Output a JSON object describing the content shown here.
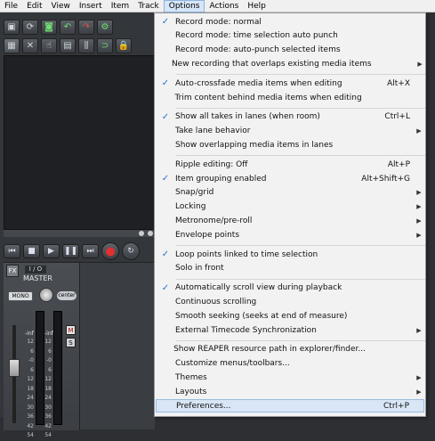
{
  "menubar": {
    "items": [
      "File",
      "Edit",
      "View",
      "Insert",
      "Item",
      "Track",
      "Options",
      "Actions",
      "Help"
    ],
    "active_index": 6
  },
  "toolbar": {
    "row1_icons": [
      "new-project-icon",
      "open-project-icon",
      "save-project-icon",
      "undo-icon",
      "redo-icon",
      "settings-icon"
    ],
    "row2_icons": [
      "grid-icon",
      "snap-icon",
      "ripple-icon",
      "envelope-icon",
      "lock-icon",
      "lock-icon"
    ]
  },
  "transport": {
    "buttons": [
      "go-to-start",
      "stop",
      "play",
      "pause",
      "go-to-end",
      "record",
      "loop"
    ]
  },
  "mixer": {
    "io_label": "I / O",
    "track_name": "MASTER",
    "mono_label": "MONO",
    "pan_label": "center",
    "fx_label": "FX",
    "mute": "M",
    "solo": "S",
    "inf_left": "-inf",
    "inf_right": "-inf",
    "ticks": [
      "12",
      "6",
      "-0",
      "6",
      "12",
      "18",
      "24",
      "30",
      "36",
      "42",
      "54"
    ]
  },
  "options_menu": {
    "sections": [
      [
        {
          "label": "Record mode: normal",
          "checked": true,
          "shortcut": "",
          "submenu": false
        },
        {
          "label": "Record mode: time selection auto punch",
          "checked": false,
          "shortcut": "",
          "submenu": false
        },
        {
          "label": "Record mode: auto-punch selected items",
          "checked": false,
          "shortcut": "",
          "submenu": false
        },
        {
          "label": "New recording that overlaps existing media items",
          "checked": false,
          "shortcut": "",
          "submenu": true
        }
      ],
      [
        {
          "label": "Auto-crossfade media items when editing",
          "checked": true,
          "shortcut": "Alt+X",
          "submenu": false
        },
        {
          "label": "Trim content behind media items when editing",
          "checked": false,
          "shortcut": "",
          "submenu": false
        }
      ],
      [
        {
          "label": "Show all takes in lanes (when room)",
          "checked": true,
          "shortcut": "Ctrl+L",
          "submenu": false
        },
        {
          "label": "Take lane behavior",
          "checked": false,
          "shortcut": "",
          "submenu": true
        },
        {
          "label": "Show overlapping media items in lanes",
          "checked": false,
          "shortcut": "",
          "submenu": false
        }
      ],
      [
        {
          "label": "Ripple editing: Off",
          "checked": false,
          "shortcut": "Alt+P",
          "submenu": false
        },
        {
          "label": "Item grouping enabled",
          "checked": true,
          "shortcut": "Alt+Shift+G",
          "submenu": false
        },
        {
          "label": "Snap/grid",
          "checked": false,
          "shortcut": "",
          "submenu": true
        },
        {
          "label": "Locking",
          "checked": false,
          "shortcut": "",
          "submenu": true
        },
        {
          "label": "Metronome/pre-roll",
          "checked": false,
          "shortcut": "",
          "submenu": true
        },
        {
          "label": "Envelope points",
          "checked": false,
          "shortcut": "",
          "submenu": true
        }
      ],
      [
        {
          "label": "Loop points linked to time selection",
          "checked": true,
          "shortcut": "",
          "submenu": false
        },
        {
          "label": "Solo in front",
          "checked": false,
          "shortcut": "",
          "submenu": false
        }
      ],
      [
        {
          "label": "Automatically scroll view during playback",
          "checked": true,
          "shortcut": "",
          "submenu": false
        },
        {
          "label": "Continuous scrolling",
          "checked": false,
          "shortcut": "",
          "submenu": false
        },
        {
          "label": "Smooth seeking (seeks at end of measure)",
          "checked": false,
          "shortcut": "",
          "submenu": false
        },
        {
          "label": "External Timecode Synchronization",
          "checked": false,
          "shortcut": "",
          "submenu": true
        }
      ],
      [
        {
          "label": "Show REAPER resource path in explorer/finder...",
          "checked": false,
          "shortcut": "",
          "submenu": false
        },
        {
          "label": "Customize menus/toolbars...",
          "checked": false,
          "shortcut": "",
          "submenu": false
        },
        {
          "label": "Themes",
          "checked": false,
          "shortcut": "",
          "submenu": true
        },
        {
          "label": "Layouts",
          "checked": false,
          "shortcut": "",
          "submenu": true
        },
        {
          "label": "Preferences...",
          "checked": false,
          "shortcut": "Ctrl+P",
          "submenu": false,
          "hover": true
        }
      ]
    ]
  },
  "colors": {
    "menu_bg": "#f2f2f2",
    "check_color": "#2b6fd1",
    "hover_bg": "#d8e6f6",
    "app_bg": "#33363a"
  }
}
